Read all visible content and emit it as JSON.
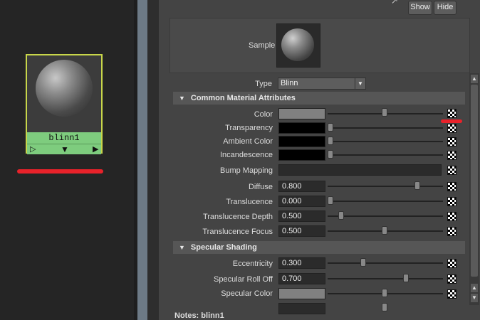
{
  "hypershade": {
    "node_name": "blinn1"
  },
  "header": {
    "show_label": "Show",
    "hide_label": "Hide"
  },
  "sample": {
    "label": "Sample"
  },
  "type": {
    "label": "Type",
    "value": "Blinn"
  },
  "sections": {
    "common": "Common Material Attributes",
    "specular": "Specular Shading"
  },
  "common_attrs": [
    {
      "label": "Color",
      "value": ""
    },
    {
      "label": "Transparency",
      "value": ""
    },
    {
      "label": "Ambient Color",
      "value": ""
    },
    {
      "label": "Incandescence",
      "value": ""
    },
    {
      "label": "Bump Mapping",
      "value": ""
    },
    {
      "label": "Diffuse",
      "value": "0.800"
    },
    {
      "label": "Translucence",
      "value": "0.000"
    },
    {
      "label": "Translucence Depth",
      "value": "0.500"
    },
    {
      "label": "Translucence Focus",
      "value": "0.500"
    }
  ],
  "specular_attrs": [
    {
      "label": "Eccentricity",
      "value": "0.300"
    },
    {
      "label": "Specular Roll Off",
      "value": "0.700"
    },
    {
      "label": "Specular Color",
      "value": ""
    }
  ],
  "slider_levels": {
    "color": 0.55,
    "transparency": 0.0,
    "ambient": 0.0,
    "incandescence": 0.0,
    "diffuse": 0.8,
    "translucence": 0.0,
    "translucence_depth": 0.1,
    "translucence_focus": 0.5,
    "eccentricity": 0.3,
    "specular_roll_off": 0.7,
    "specular_color": 0.5
  },
  "colors": {
    "color_swatch": "#808080",
    "black_swatch": "#000000",
    "node_border": "#c8d64a",
    "node_label_bg": "#7ecc7e",
    "annotation_red": "#e8222a"
  },
  "notes": {
    "label": "Notes:",
    "value": "blinn1"
  }
}
